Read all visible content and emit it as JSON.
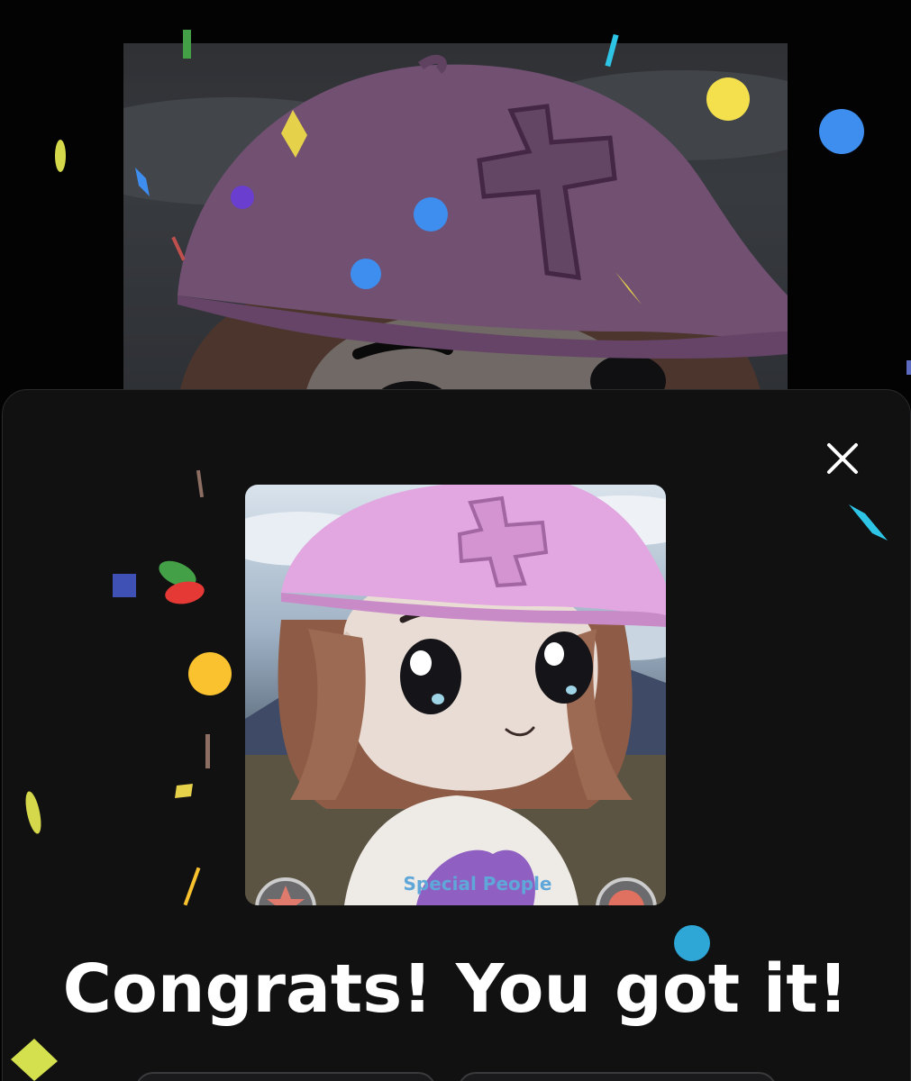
{
  "modal": {
    "headline": "Congrats! You got it!",
    "close_icon": "close-icon",
    "accent_color": "#ffffff"
  },
  "avatar": {
    "hat_color": "#e2a6e0",
    "shirt_text": "Special People",
    "badges": [
      "star-badge-icon",
      "chat-badge-icon"
    ]
  },
  "confetti_colors": [
    "#f4e04d",
    "#3e8ef0",
    "#e53935",
    "#43a047",
    "#5c6bc0",
    "#f9c22e",
    "#2ec4e6",
    "#8e5cd6",
    "#8d6e63"
  ]
}
